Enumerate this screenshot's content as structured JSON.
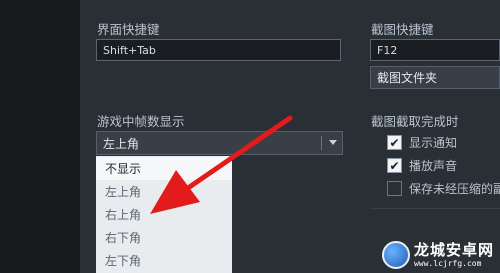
{
  "settings": {
    "ui_shortcut": {
      "label": "界面快捷键",
      "value": "Shift+Tab"
    },
    "screenshot_shortcut": {
      "label": "截图快捷键",
      "value": "F12",
      "folder_button": "截图文件夹"
    },
    "fps_display": {
      "label": "游戏中帧数显示",
      "selected": "左上角",
      "options": [
        "不显示",
        "左上角",
        "右上角",
        "右下角",
        "左下角"
      ],
      "highlighted_option": "右上角"
    },
    "screenshot_complete": {
      "label": "截图截取完成时",
      "options": [
        {
          "label": "显示通知",
          "checked": true
        },
        {
          "label": "播放声音",
          "checked": true
        },
        {
          "label": "保存未经压缩的副",
          "checked": false
        }
      ]
    }
  },
  "watermark": {
    "text": "龙城安卓网",
    "url": "www.lcjrfg.com"
  },
  "colors": {
    "arrow": "#e31b1b",
    "panel": "#2a2e35",
    "dropdown_bg": "#e8ecef"
  }
}
